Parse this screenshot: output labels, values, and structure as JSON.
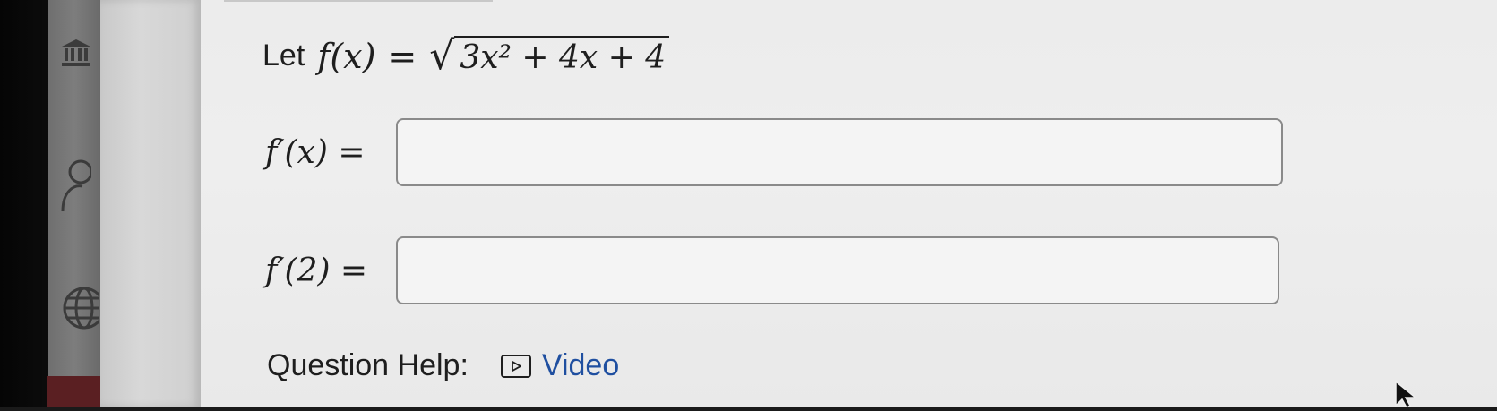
{
  "problem": {
    "prefix": "Let",
    "function": "f(x)",
    "equals": "=",
    "radicand": "3x² + 4x + 4"
  },
  "answers": [
    {
      "label": "f′(x) =",
      "value": ""
    },
    {
      "label": "f′(2) =",
      "value": ""
    }
  ],
  "help": {
    "label": "Question Help:",
    "video_label": "Video"
  },
  "colors": {
    "link": "#1f4fa0",
    "text": "#1e1e1e",
    "panel": "#ececec"
  }
}
